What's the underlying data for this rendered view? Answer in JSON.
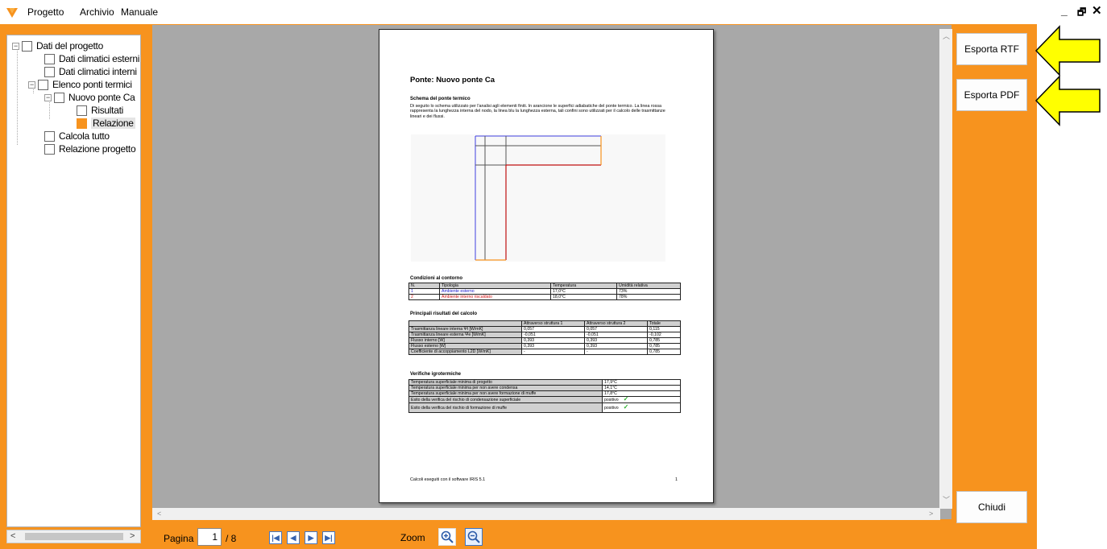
{
  "menu": {
    "items": [
      "Progetto",
      "Archivio",
      "Manuale"
    ]
  },
  "window_controls": {
    "minimize": "_",
    "maximize": "🗗",
    "close": "✕"
  },
  "tree": {
    "items": [
      {
        "label": "Dati del progetto"
      },
      {
        "label": "Dati climatici esterni"
      },
      {
        "label": "Dati climatici interni"
      },
      {
        "label": "Elenco ponti termici"
      },
      {
        "label": "Nuovo ponte Ca"
      },
      {
        "label": "Risultati"
      },
      {
        "label": "Relazione"
      },
      {
        "label": "Calcola tutto"
      },
      {
        "label": "Relazione progetto"
      }
    ]
  },
  "document": {
    "title": "Ponte: Nuovo ponte Ca",
    "schema_heading": "Schema del ponte termico",
    "schema_text": "Di seguito lo schema utilizzato per l'analisi agli elementi finiti. In arancione le superfici adiabatiche del ponte termico. La linea rossa rappresenta la lunghezza interna del nodo, la linea blu la lunghezza esterna, tali confini sono utilizzati per il calcolo delle trasmittanze lineari e dei flussi.",
    "conditions_heading": "Condizioni al contorno",
    "conditions_table": {
      "headers": [
        "N.",
        "Tipologia",
        "Temperatura",
        "Umidità relativa"
      ],
      "rows": [
        [
          "1",
          "Ambiente esterno",
          "17,0°C",
          "73%"
        ],
        [
          "2",
          "Ambiente interno riscaldato",
          "18,0°C",
          "78%"
        ]
      ]
    },
    "results_heading": "Principali risultati del calcolo",
    "results_table": {
      "headers": [
        "",
        "Attraverso struttura 1",
        "Attraverso struttura 2",
        "Totale"
      ],
      "rows": [
        [
          "Trasmittanza lineare interna Ψi [W/mK]",
          "0,057",
          "0,057",
          "0,115"
        ],
        [
          "Trasmittanza lineare esterna Ψe [W/mK]",
          "-0,051",
          "-0,051",
          "-0,102"
        ],
        [
          "Flusso interno [W]",
          "0,393",
          "0,393",
          "0,785"
        ],
        [
          "Flusso esterno [W]",
          "0,393",
          "0,393",
          "0,785"
        ],
        [
          "Coefficiente di accoppiamento L2D [W/mK]",
          "-",
          "-",
          "0,785"
        ]
      ]
    },
    "hygro_heading": "Verifiche igrotermiche",
    "hygro_table": {
      "rows": [
        [
          "Temperatura superficiale minima di progetto",
          "17,9°C"
        ],
        [
          "Temperatura superficiale minima per non avere condensa",
          "14,1°C"
        ],
        [
          "Temperatura superficiale minima per non avere formazione di muffe",
          "17,8°C"
        ],
        [
          "Esito della verifica del rischio di condensazione superficiale",
          "positivo"
        ],
        [
          "Esito della verifica del rischio di formazione di muffe",
          "positivo"
        ]
      ]
    },
    "footer": "Calcoli eseguiti con il software IRIS 5.1",
    "page_number": "1"
  },
  "navigation": {
    "pagina_label": "Pagina",
    "current_page": "1",
    "total_label": "/ 8",
    "zoom_label": "Zoom"
  },
  "buttons": {
    "export_rtf": "Esporta RTF",
    "export_pdf": "Esporta PDF",
    "close": "Chiudi"
  },
  "colors": {
    "accent": "#f7931e",
    "highlight_arrow": "#ffff00",
    "viewer_bg": "#a8a8a8"
  }
}
